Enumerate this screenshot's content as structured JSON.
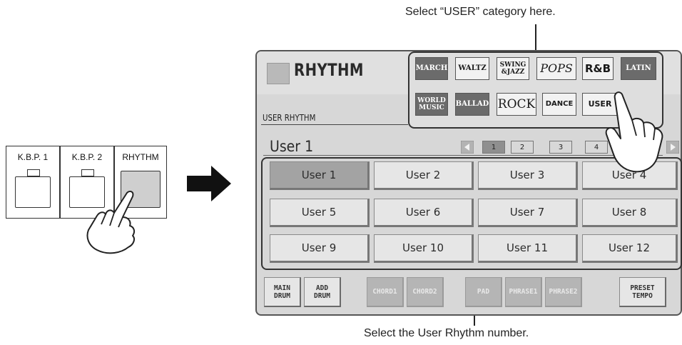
{
  "callouts": {
    "top": "Select “USER” category here.",
    "bottom": "Select the User Rhythm number."
  },
  "panel_buttons": [
    {
      "label": "K.B.P. 1"
    },
    {
      "label": "K.B.P. 2"
    },
    {
      "label": "RHYTHM"
    }
  ],
  "screen": {
    "title": "RHYTHM",
    "subtitle": "USER RHYTHM",
    "current_rhythm": "User 1",
    "categories_row1": [
      "MARCH",
      "WALTZ",
      "SWING\n&JAZZ",
      "POPS",
      "R&B",
      "LATIN"
    ],
    "categories_row2": [
      "WORLD\nMUSIC",
      "BALLAD",
      "ROCK",
      "DANCE",
      "USER"
    ],
    "pages": [
      "1",
      "2",
      "3",
      "4"
    ],
    "selected_page": "1",
    "rhythms": [
      "User 1",
      "User 2",
      "User 3",
      "User 4",
      "User 5",
      "User 6",
      "User 7",
      "User 8",
      "User 9",
      "User 10",
      "User 11",
      "User 12"
    ],
    "selected_rhythm": "User 1",
    "tabs": [
      {
        "label": "MAIN\nDRUM",
        "enabled": true
      },
      {
        "label": "ADD\nDRUM",
        "enabled": true
      },
      {
        "label": "CHORD1",
        "enabled": false
      },
      {
        "label": "CHORD2",
        "enabled": false
      },
      {
        "label": "PAD",
        "enabled": false
      },
      {
        "label": "PHRASE1",
        "enabled": false
      },
      {
        "label": "PHRASE2",
        "enabled": false
      },
      {
        "label": "PRESET\nTEMPO",
        "enabled": true
      }
    ]
  },
  "icons": [
    "hand-pointer-icon",
    "right-arrow-icon",
    "page-left-arrow-icon",
    "page-right-arrow-icon"
  ],
  "colors": {
    "selected": "#a3a3a3",
    "screen_bg": "#d7d7d7"
  }
}
